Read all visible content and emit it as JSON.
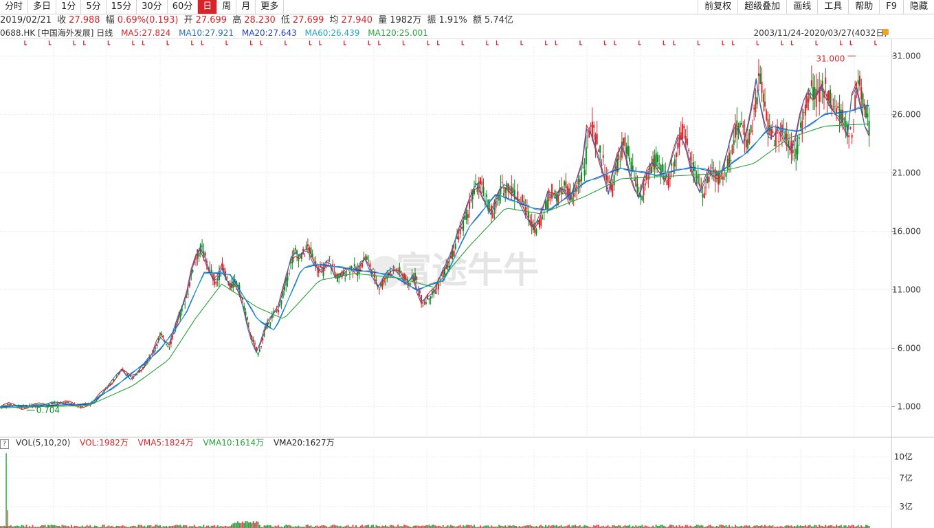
{
  "toolbar": {
    "left": [
      "分时",
      "多日",
      "1分",
      "5分",
      "15分",
      "30分",
      "60分",
      "日",
      "周",
      "月",
      "更多"
    ],
    "active_index": 7,
    "right": [
      "前复权",
      "超级叠加",
      "画线",
      "工具",
      "帮助",
      "F9",
      "隐藏"
    ]
  },
  "info": {
    "date": "2019/02/21",
    "close_label": "收",
    "close": "27.988",
    "change_label": "幅",
    "change": "0.69%(0.193)",
    "open_label": "开",
    "open": "27.699",
    "high_label": "高",
    "high": "28.230",
    "low_label": "低",
    "low": "27.699",
    "avg_label": "均",
    "avg": "27.940",
    "vol_label": "量",
    "vol": "1982万",
    "amp_label": "振",
    "amp": "1.91%",
    "amt_label": "额",
    "amt": "5.74亿"
  },
  "ma": {
    "code": "0688.HK [中国海外发展] 日线",
    "ma5": "MA5:27.824",
    "ma10": "MA10:27.921",
    "ma20": "MA20:27.643",
    "ma60": "MA60:26.439",
    "ma120": "MA120:25.001",
    "range": "2003/11/24-2020/03/27(4032日)"
  },
  "vol": {
    "title": "VOL(5,10,20)",
    "vol": "VOL:1982万",
    "vma5": "VMA5:1824万",
    "vma10": "VMA10:1614万",
    "vma20": "VMA20:1627万",
    "help": "?"
  },
  "colors": {
    "up": "#d7242a",
    "down": "#0b8a1d",
    "ma5": "#d7242a",
    "ma10": "#2a6ebd",
    "ma20": "#1f3fd0",
    "ma60": "#22a5c8",
    "ma120": "#26a339"
  },
  "watermark": "富途牛牛",
  "chart_data": {
    "type": "line",
    "title": "",
    "price_axis": {
      "ticks": [
        "31.000",
        "26.000",
        "21.000",
        "16.000",
        "11.000",
        "6.000",
        "1.000"
      ],
      "range": [
        -1.5,
        32.5
      ]
    },
    "volume_axis": {
      "ticks": [
        "10亿",
        "7亿",
        "3亿"
      ],
      "range": [
        0,
        11
      ]
    },
    "annotations": {
      "max": "31.000",
      "min": "0.704"
    },
    "close_path": [
      [
        0,
        0.95
      ],
      [
        0.012,
        1.2
      ],
      [
        0.025,
        0.95
      ],
      [
        0.04,
        1.1
      ],
      [
        0.06,
        1.25
      ],
      [
        0.075,
        1.35
      ],
      [
        0.09,
        1.05
      ],
      [
        0.105,
        1.3
      ],
      [
        0.115,
        2.2
      ],
      [
        0.125,
        3.0
      ],
      [
        0.137,
        4.2
      ],
      [
        0.148,
        3.4
      ],
      [
        0.16,
        4.3
      ],
      [
        0.172,
        5.6
      ],
      [
        0.18,
        7.2
      ],
      [
        0.19,
        6.1
      ],
      [
        0.2,
        8.5
      ],
      [
        0.21,
        10.5
      ],
      [
        0.218,
        13.5
      ],
      [
        0.226,
        14.6
      ],
      [
        0.234,
        13.0
      ],
      [
        0.242,
        11.5
      ],
      [
        0.25,
        13.0
      ],
      [
        0.258,
        11.2
      ],
      [
        0.266,
        11.8
      ],
      [
        0.274,
        9.5
      ],
      [
        0.282,
        7.0
      ],
      [
        0.29,
        5.5
      ],
      [
        0.298,
        7.6
      ],
      [
        0.306,
        8.8
      ],
      [
        0.314,
        9.5
      ],
      [
        0.322,
        12.0
      ],
      [
        0.33,
        14.2
      ],
      [
        0.338,
        13.8
      ],
      [
        0.346,
        14.7
      ],
      [
        0.354,
        13.2
      ],
      [
        0.362,
        12.5
      ],
      [
        0.37,
        13.6
      ],
      [
        0.378,
        12.0
      ],
      [
        0.386,
        12.3
      ],
      [
        0.394,
        13.0
      ],
      [
        0.402,
        12.5
      ],
      [
        0.41,
        13.9
      ],
      [
        0.418,
        12.6
      ],
      [
        0.426,
        11.2
      ],
      [
        0.434,
        12.2
      ],
      [
        0.442,
        12.8
      ],
      [
        0.45,
        12.5
      ],
      [
        0.458,
        11.5
      ],
      [
        0.466,
        12.2
      ],
      [
        0.474,
        9.8
      ],
      [
        0.482,
        10.5
      ],
      [
        0.49,
        11.0
      ],
      [
        0.498,
        12.5
      ],
      [
        0.506,
        13.5
      ],
      [
        0.514,
        15.5
      ],
      [
        0.522,
        17.0
      ],
      [
        0.53,
        19.0
      ],
      [
        0.538,
        20.2
      ],
      [
        0.546,
        18.5
      ],
      [
        0.554,
        17.5
      ],
      [
        0.562,
        19.5
      ],
      [
        0.57,
        20.0
      ],
      [
        0.578,
        19.2
      ],
      [
        0.586,
        18.5
      ],
      [
        0.594,
        17.2
      ],
      [
        0.602,
        16.2
      ],
      [
        0.61,
        17.5
      ],
      [
        0.618,
        19.5
      ],
      [
        0.626,
        18.8
      ],
      [
        0.634,
        20.0
      ],
      [
        0.642,
        18.5
      ],
      [
        0.65,
        20.5
      ],
      [
        0.656,
        21.5
      ],
      [
        0.662,
        25.2
      ],
      [
        0.668,
        24.0
      ],
      [
        0.674,
        22.5
      ],
      [
        0.68,
        21.0
      ],
      [
        0.686,
        19.2
      ],
      [
        0.692,
        21.5
      ],
      [
        0.7,
        23.5
      ],
      [
        0.706,
        22.3
      ],
      [
        0.712,
        20.3
      ],
      [
        0.72,
        18.8
      ],
      [
        0.728,
        21.0
      ],
      [
        0.736,
        22.0
      ],
      [
        0.744,
        21.2
      ],
      [
        0.75,
        20.3
      ],
      [
        0.758,
        22.5
      ],
      [
        0.766,
        24.5
      ],
      [
        0.774,
        23.0
      ],
      [
        0.782,
        20.5
      ],
      [
        0.79,
        19.2
      ],
      [
        0.798,
        21.3
      ],
      [
        0.806,
        20.5
      ],
      [
        0.814,
        21.0
      ],
      [
        0.822,
        23.5
      ],
      [
        0.83,
        25.5
      ],
      [
        0.838,
        23.5
      ],
      [
        0.846,
        25.8
      ],
      [
        0.852,
        29.3
      ],
      [
        0.858,
        26.5
      ],
      [
        0.864,
        24.5
      ],
      [
        0.87,
        23.8
      ],
      [
        0.878,
        25.0
      ],
      [
        0.886,
        23.5
      ],
      [
        0.894,
        22.8
      ],
      [
        0.902,
        26.0
      ],
      [
        0.91,
        28.2
      ],
      [
        0.918,
        27.2
      ],
      [
        0.926,
        28.5
      ],
      [
        0.934,
        27.0
      ],
      [
        0.942,
        26.0
      ],
      [
        0.95,
        25.3
      ],
      [
        0.956,
        24.0
      ],
      [
        0.962,
        29.0
      ],
      [
        0.966,
        28.3
      ],
      [
        0.97,
        26.8
      ],
      [
        0.975,
        25.0
      ],
      [
        0.98,
        24.3
      ]
    ],
    "ma_path": [
      [
        0,
        1.0
      ],
      [
        0.05,
        1.1
      ],
      [
        0.1,
        1.2
      ],
      [
        0.14,
        3.3
      ],
      [
        0.18,
        5.8
      ],
      [
        0.21,
        9.0
      ],
      [
        0.23,
        12.5
      ],
      [
        0.26,
        12.3
      ],
      [
        0.29,
        8.5
      ],
      [
        0.31,
        7.5
      ],
      [
        0.34,
        12.8
      ],
      [
        0.36,
        13.2
      ],
      [
        0.4,
        12.7
      ],
      [
        0.44,
        12.3
      ],
      [
        0.47,
        11.0
      ],
      [
        0.5,
        11.8
      ],
      [
        0.53,
        16.5
      ],
      [
        0.56,
        19.2
      ],
      [
        0.6,
        18.0
      ],
      [
        0.62,
        17.8
      ],
      [
        0.66,
        20.2
      ],
      [
        0.7,
        21.4
      ],
      [
        0.74,
        20.8
      ],
      [
        0.78,
        21.5
      ],
      [
        0.81,
        21.0
      ],
      [
        0.84,
        22.6
      ],
      [
        0.87,
        25.0
      ],
      [
        0.9,
        24.5
      ],
      [
        0.93,
        26.0
      ],
      [
        0.96,
        26.3
      ],
      [
        0.98,
        26.8
      ]
    ],
    "ma_long_path": [
      [
        0,
        0.9
      ],
      [
        0.05,
        1.0
      ],
      [
        0.1,
        1.1
      ],
      [
        0.15,
        2.8
      ],
      [
        0.19,
        5.0
      ],
      [
        0.22,
        8.5
      ],
      [
        0.25,
        11.5
      ],
      [
        0.29,
        9.5
      ],
      [
        0.32,
        8.5
      ],
      [
        0.36,
        11.8
      ],
      [
        0.4,
        12.4
      ],
      [
        0.45,
        12.0
      ],
      [
        0.49,
        11.2
      ],
      [
        0.53,
        14.8
      ],
      [
        0.57,
        18.0
      ],
      [
        0.61,
        17.5
      ],
      [
        0.66,
        19.0
      ],
      [
        0.7,
        20.5
      ],
      [
        0.75,
        20.7
      ],
      [
        0.8,
        20.9
      ],
      [
        0.85,
        21.8
      ],
      [
        0.89,
        24.0
      ],
      [
        0.93,
        25.0
      ],
      [
        0.98,
        25.2
      ]
    ],
    "volume_path": [
      [
        0.006,
        1
      ],
      [
        0.007,
        10.5
      ],
      [
        0.009,
        0.5
      ],
      [
        0.28,
        0.4
      ],
      [
        0.29,
        1.8
      ],
      [
        0.3,
        0.4
      ],
      [
        0.98,
        0.3
      ]
    ],
    "markers_count": 44
  }
}
